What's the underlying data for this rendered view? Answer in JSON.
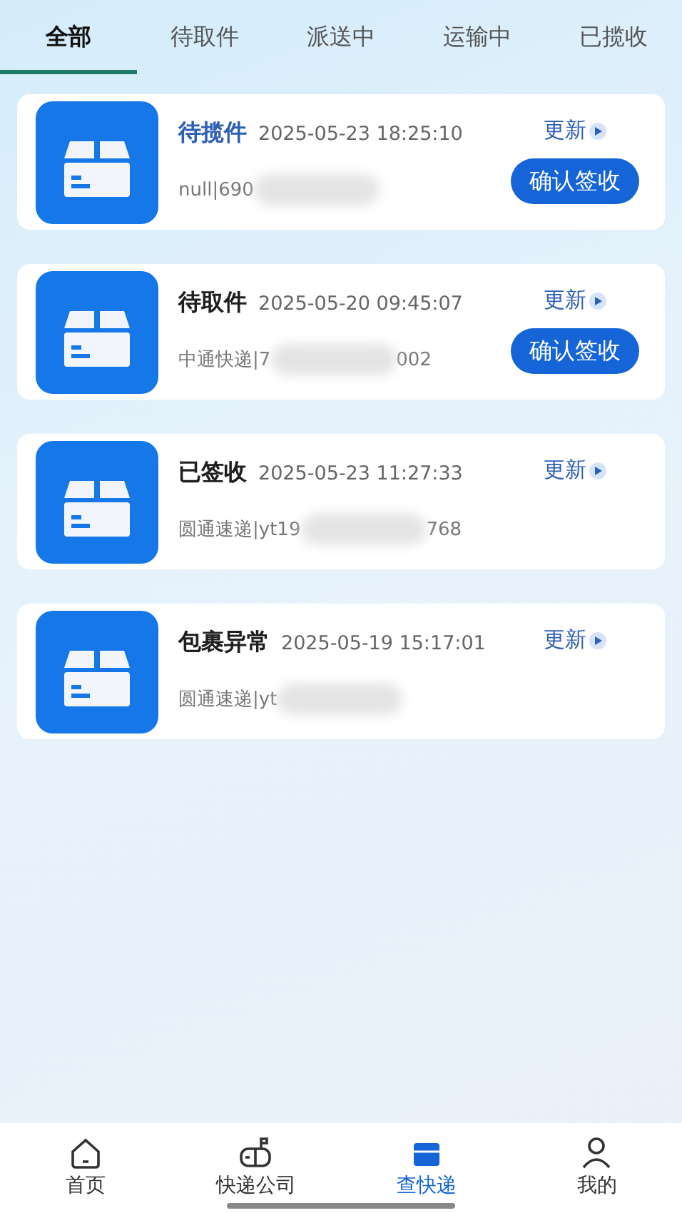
{
  "tabs": [
    {
      "label": "全部",
      "selected": true
    },
    {
      "label": "待取件",
      "selected": false
    },
    {
      "label": "派送中",
      "selected": false
    },
    {
      "label": "运输中",
      "selected": false
    },
    {
      "label": "已揽收",
      "selected": false
    }
  ],
  "parcels": [
    {
      "status": "待揽件",
      "color": "#2d5fb4",
      "time": "2025-05-23 18:25:10",
      "refresh": "更新",
      "tracking_start": "null|690",
      "action": "确认签收"
    },
    {
      "status": "待取件",
      "color": "#1f1f1f",
      "time": "2025-05-20 09:45:07",
      "refresh": "更新",
      "tracking_start": "中通快递|7",
      "tracking_end": "002",
      "action": "确认签收"
    },
    {
      "status": "已签收",
      "color": "#1f1f1f",
      "time": "2025-05-23 11:27:33",
      "refresh": "更新",
      "tracking_start": "圆通速递|yt19",
      "tracking_end": "768"
    },
    {
      "status": "包裹异常",
      "color": "#1f1f1f",
      "time": "2025-05-19 15:17:01",
      "refresh": "更新",
      "tracking_start": "圆通速递|yt"
    }
  ],
  "nav": [
    {
      "label": "首页",
      "kind": "home",
      "selected": false
    },
    {
      "label": "快递公司",
      "kind": "mailbox",
      "selected": false
    },
    {
      "label": "查快递",
      "kind": "parcel",
      "selected": true
    },
    {
      "label": "我的",
      "kind": "person",
      "selected": false
    }
  ]
}
